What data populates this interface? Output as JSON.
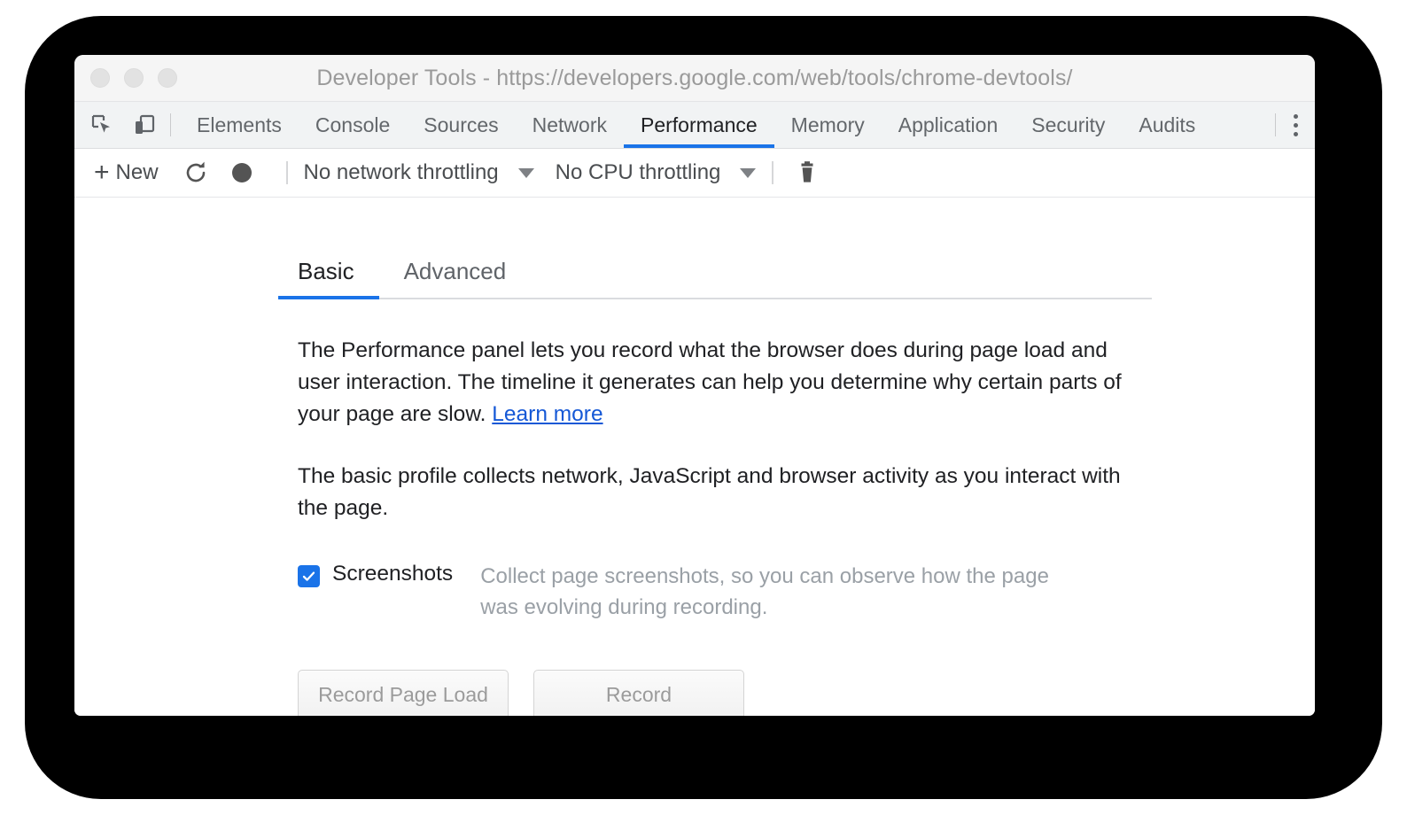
{
  "window": {
    "title": "Developer Tools - https://developers.google.com/web/tools/chrome-devtools/",
    "traffic_lights": [
      "close",
      "minimize",
      "maximize"
    ]
  },
  "tabbar": {
    "icons": [
      {
        "name": "inspect-element-icon",
        "label": "Inspect element"
      },
      {
        "name": "toggle-device-toolbar-icon",
        "label": "Toggle device toolbar"
      }
    ],
    "tabs": [
      {
        "label": "Elements",
        "active": false
      },
      {
        "label": "Console",
        "active": false
      },
      {
        "label": "Sources",
        "active": false
      },
      {
        "label": "Network",
        "active": false
      },
      {
        "label": "Performance",
        "active": true
      },
      {
        "label": "Memory",
        "active": false
      },
      {
        "label": "Application",
        "active": false
      },
      {
        "label": "Security",
        "active": false
      },
      {
        "label": "Audits",
        "active": false
      }
    ],
    "more_menu_label": "Customize and control DevTools",
    "active_accent": "#1a73e8"
  },
  "toolbar": {
    "new_label": "New",
    "reload_label": "Start profiling and reload page",
    "record_label": "Record",
    "network_throttling": "No network throttling",
    "cpu_throttling": "No CPU throttling",
    "clear_label": "Clear"
  },
  "panel": {
    "subtabs": [
      {
        "label": "Basic",
        "active": true
      },
      {
        "label": "Advanced",
        "active": false
      }
    ],
    "paragraph_1_before_link": "The Performance panel lets you record what the browser does during page load and user interaction. The timeline it generates can help you determine why certain parts of your page are slow. ",
    "paragraph_1_link": "Learn more",
    "paragraph_2": "The basic profile collects network, JavaScript and browser activity as you interact with the page.",
    "screenshots": {
      "checked": true,
      "label": "Screenshots",
      "description": "Collect page screenshots, so you can observe how the page was evolving during recording."
    },
    "buttons": {
      "record_page_load": "Record Page Load",
      "record": "Record"
    }
  },
  "colors": {
    "accent": "#1a73e8",
    "link": "#1558d6",
    "text": "#202124",
    "muted": "#9aa0a6",
    "tabbar_bg": "#f1f3f4",
    "titlebar_bg": "#f5f5f5",
    "bezel": "#000000"
  }
}
